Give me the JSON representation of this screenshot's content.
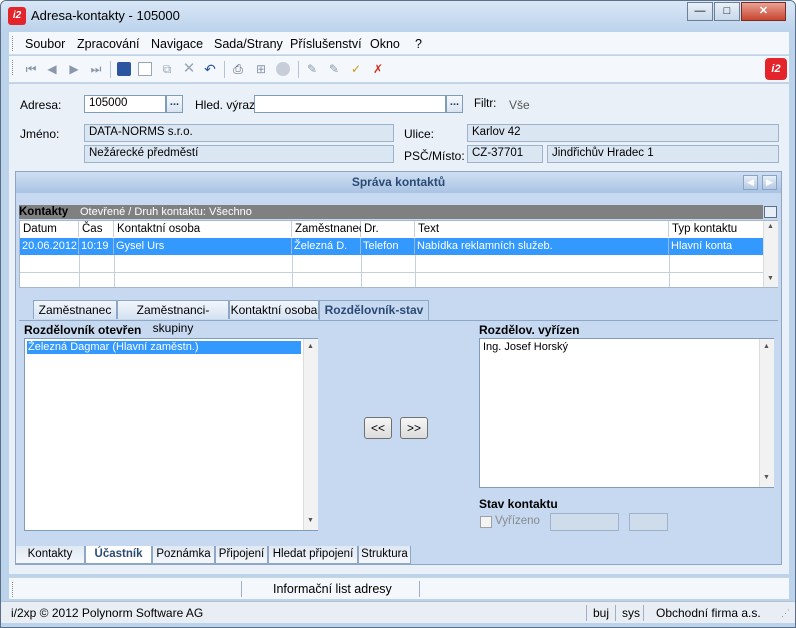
{
  "window": {
    "title": "Adresa-kontakty - 105000",
    "app_icon": "i2",
    "btn_min": "—",
    "btn_max": "□",
    "btn_close": "✕"
  },
  "menu": [
    "Soubor",
    "Zpracování",
    "Navigace",
    "Sada/Strany",
    "Příslušenství",
    "Okno",
    "?"
  ],
  "toolbar_icons": [
    "first-record-icon",
    "previous-record-icon",
    "next-record-icon",
    "last-record-icon",
    "save-icon",
    "new-icon",
    "copy-icon",
    "delete-icon",
    "undo-icon",
    "print-icon",
    "tree-icon",
    "disabled-icon",
    "edit-pen-icon",
    "edit-pen2-icon",
    "approve-icon",
    "filter-remove-icon"
  ],
  "header": {
    "adresa_label": "Adresa:",
    "adresa_value": "105000",
    "hled_label": "Hled. výraz:",
    "hled_value": "",
    "filtr_label": "Filtr:",
    "filtr_value": "Vše",
    "jmeno_label": "Jméno:",
    "jmeno_line1": "DATA-NORMS s.r.o.",
    "jmeno_line2": "Nežárecké předměstí",
    "ulice_label": "Ulice:",
    "ulice_value": "Karlov 42",
    "psc_label": "PSČ/Místo:",
    "psc_value": "CZ-37701",
    "misto_value": "Jindřichův Hradec 1",
    "dots": "..."
  },
  "panel": {
    "title": "Správa kontaktů",
    "kontakty_label": "Kontakty",
    "kontakty_filter": "Otevřené / Druh kontaktu: Všechno",
    "columns": [
      "Datum",
      "Čas",
      "Kontaktní osoba",
      "Zaměstnanec",
      "Dr.",
      "Text",
      "Typ kontaktu"
    ],
    "rows": [
      [
        "20.06.2012",
        "10:19",
        "Gysel Urs",
        "Železná D.",
        "Telefon",
        "Nabídka reklamních služeb.",
        "Hlavní konta"
      ]
    ],
    "tabs": [
      "Zaměstnanec",
      "Zaměstnanci-skupiny",
      "Kontaktní osoba",
      "Rozdělovník-stav"
    ],
    "active_tab": "Rozdělovník-stav",
    "open_label": "Rozdělovník otevřen",
    "open_items": [
      "Železná Dagmar (Hlavní zaměstn.)"
    ],
    "done_label": "Rozdělov. vyřízen",
    "done_items": [
      "Ing. Josef Horský"
    ],
    "btn_left": "<<",
    "btn_right": ">>",
    "stav_label": "Stav kontaktu",
    "vyrizeno_label": "Vyřízeno"
  },
  "bottom_tabs": [
    "Kontakty",
    "Účastník",
    "Poznámka",
    "Připojení",
    "Hledat připojení",
    "Struktura"
  ],
  "active_bottom_tab": "Účastník",
  "info_button": "Informační list adresy",
  "status": {
    "copyright": "i/2xp © 2012 Polynorm Software AG",
    "user": "buj",
    "sys": "sys",
    "firm": "Obchodní firma a.s."
  }
}
